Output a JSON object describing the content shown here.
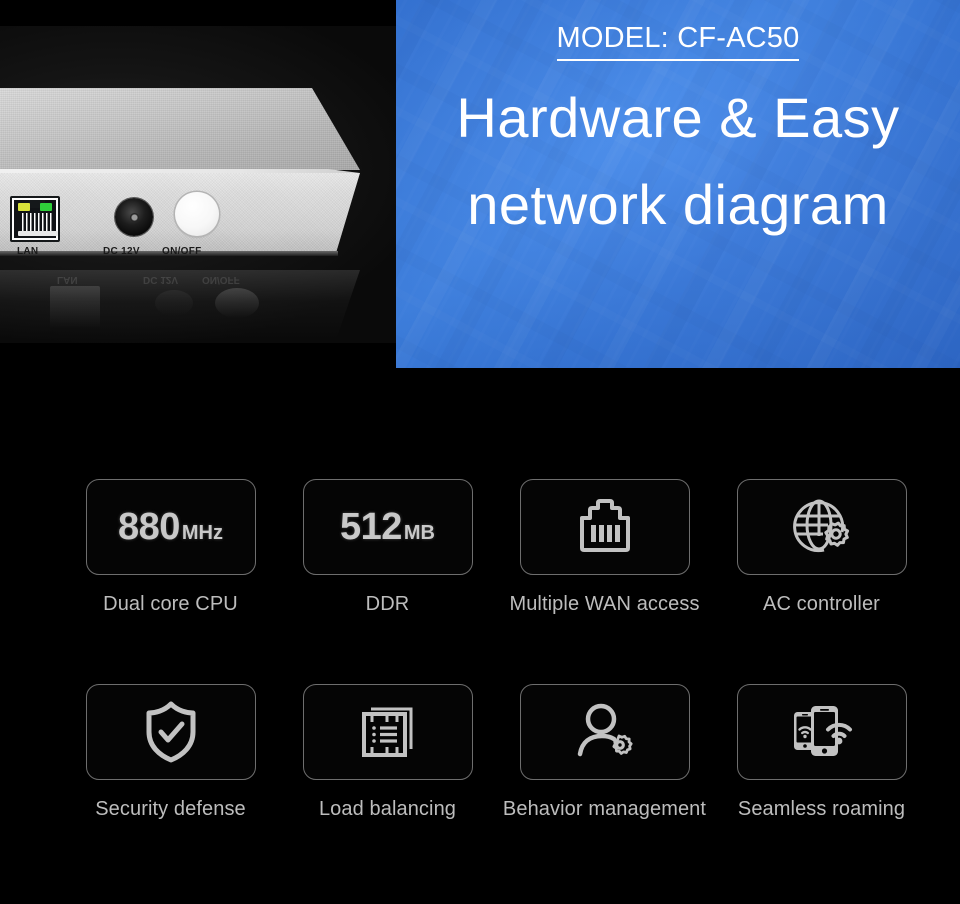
{
  "hero": {
    "product": {
      "alt": "CF-AC50 router front panel",
      "ports": [
        {
          "name": "lan-port",
          "label": "LAN"
        },
        {
          "name": "dc-jack",
          "label": "DC 12V"
        },
        {
          "name": "power-button",
          "label": "ON/OFF"
        }
      ]
    },
    "banner": {
      "model": "MODEL: CF-AC50",
      "title": "Hardware & Easy network diagram",
      "accent_color": "#3b84ea",
      "text_color": "#ffffff"
    }
  },
  "features": {
    "rows": [
      [
        {
          "icon": "cpu-speed-badge",
          "spec_number": "880",
          "spec_unit": "MHz",
          "label": "Dual core CPU"
        },
        {
          "icon": "memory-size-badge",
          "spec_number": "512",
          "spec_unit": "MB",
          "label": "DDR"
        },
        {
          "icon": "rj45-port-icon",
          "label": "Multiple WAN access"
        },
        {
          "icon": "globe-gear-icon",
          "label": "AC controller"
        }
      ],
      [
        {
          "icon": "shield-check-icon",
          "label": "Security defense"
        },
        {
          "icon": "server-stack-icon",
          "label": "Load balancing"
        },
        {
          "icon": "person-gear-icon",
          "label": "Behavior management"
        },
        {
          "icon": "phones-wifi-icon",
          "label": "Seamless roaming"
        }
      ]
    ],
    "card_border_color": "#6e6e6e",
    "label_color": "#bdbdbd",
    "icon_color": "#c2c2c2",
    "background_color": "#000000"
  }
}
